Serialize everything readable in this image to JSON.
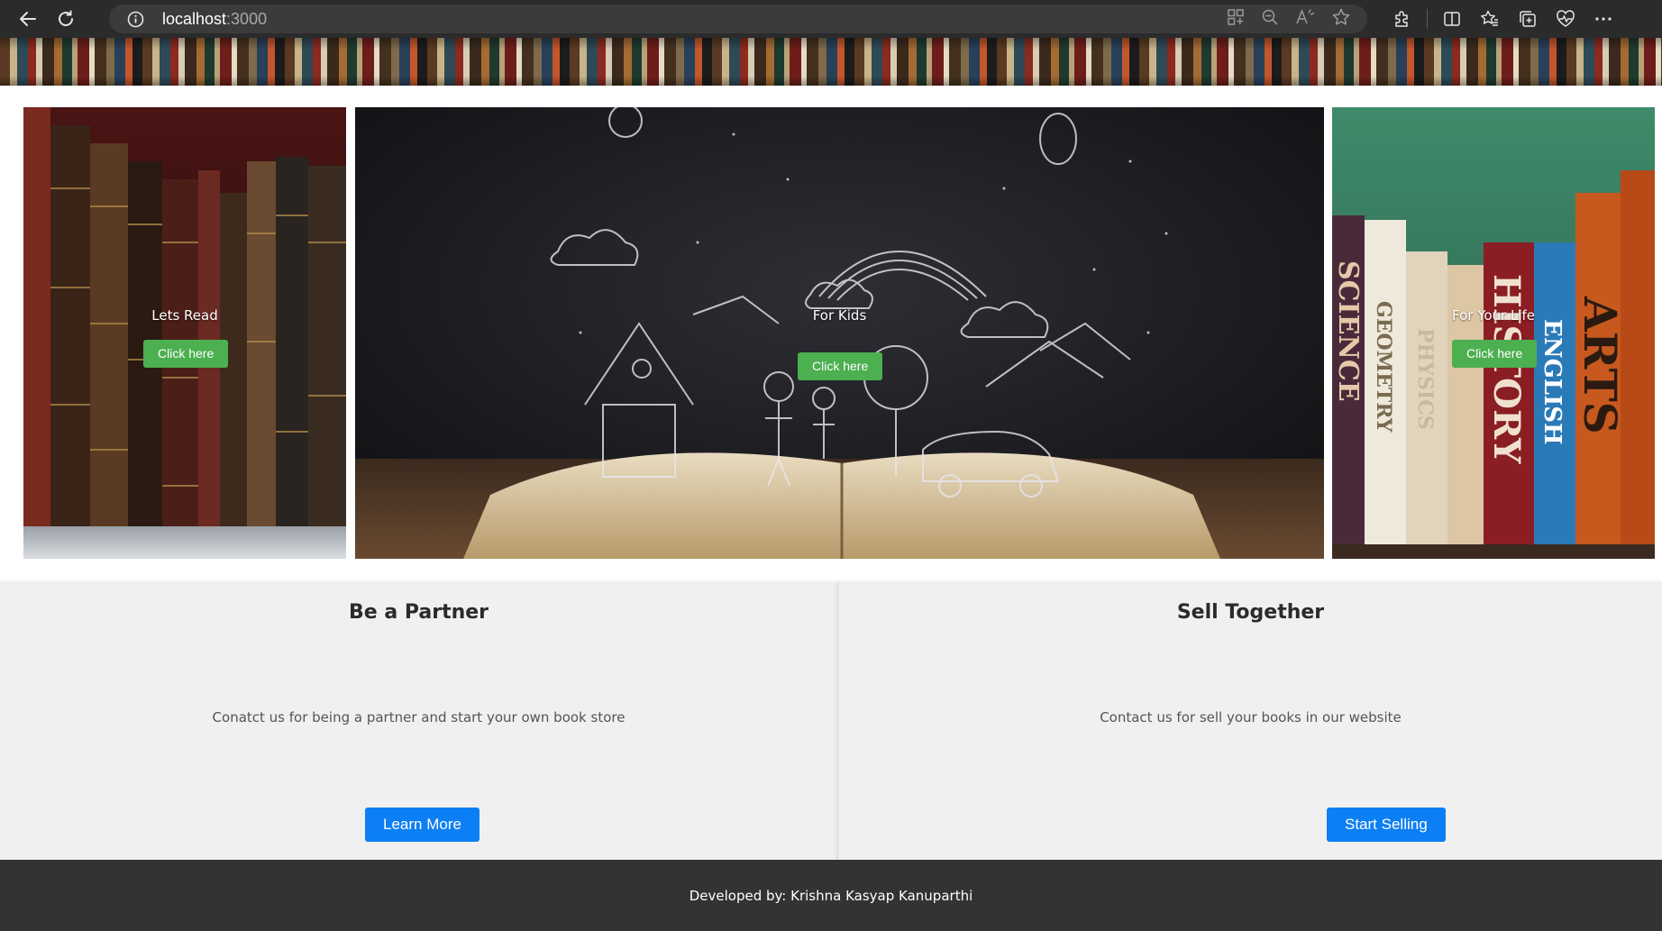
{
  "browser": {
    "url_host": "localhost",
    "url_port": ":3000",
    "icons": {
      "back": "back-arrow-icon",
      "reload": "reload-icon",
      "info": "info-icon",
      "apps": "apps-grid-icon",
      "zoom": "zoom-out-icon",
      "read_aloud": "read-aloud-icon",
      "favorite": "star-icon",
      "extensions": "puzzle-icon",
      "split": "split-screen-icon",
      "favorites": "favorites-icon",
      "collections": "collections-icon",
      "performance": "heart-pulse-icon",
      "more": "more-dots-icon"
    }
  },
  "carousel": {
    "slides": [
      {
        "caption": "Lets Read",
        "button": "Click here"
      },
      {
        "caption": "For Kids",
        "button": "Click here"
      },
      {
        "caption": "For Your Life",
        "button": "Click here"
      }
    ]
  },
  "cards": {
    "partner": {
      "title": "Be a Partner",
      "text": "Conatct us for being a partner and start your own book store",
      "button": "Learn More"
    },
    "sell": {
      "title": "Sell Together",
      "text": "Contact us for sell your books in our website",
      "button": "Start Selling"
    }
  },
  "footer": {
    "text": "Developed by: Krishna Kasyap Kanuparthi"
  },
  "colors": {
    "browser_bg": "#2b2b2b",
    "slide_button": "#4caf50",
    "card_button": "#0d7ff4",
    "card_bg": "#f0f0f0",
    "footer_bg": "#333333"
  }
}
